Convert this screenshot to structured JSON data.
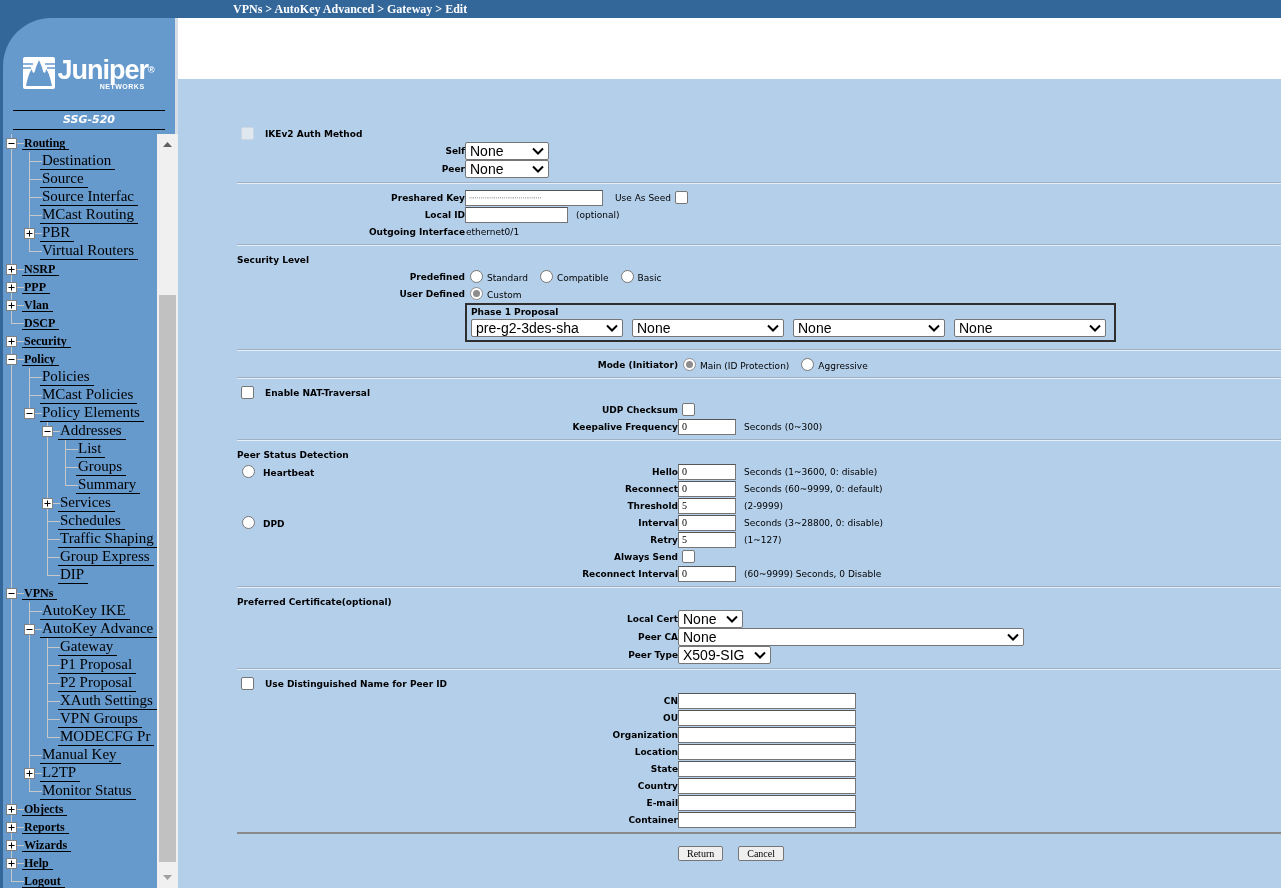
{
  "breadcrumb": "VPNs > AutoKey Advanced > Gateway > Edit",
  "logo": {
    "name": "Juniper$^{®}$",
    "sub": "NETWORKS",
    "model": "SSG-520"
  },
  "tree": [
    {
      "children": [
        {
          "label": "Routing",
          "expanded": true,
          "children": [
            {
              "label": "Destination"
            },
            {
              "label": "Source"
            },
            {
              "label": "Source Interfac"
            },
            {
              "label": "MCast Routing"
            },
            {
              "label": "PBR",
              "expanded": false
            },
            {
              "label": "Virtual Routers"
            }
          ]
        },
        {
          "label": "NSRP",
          "expanded": false
        },
        {
          "label": "PPP",
          "expanded": false
        },
        {
          "label": "Vlan",
          "expanded": false
        },
        {
          "label": "DSCP"
        }
      ]
    },
    {
      "label": "Security",
      "expanded": false
    },
    {
      "label": "Policy",
      "expanded": true,
      "children": [
        {
          "label": "Policies"
        },
        {
          "label": "MCast Policies"
        },
        {
          "label": "Policy Elements",
          "expanded": true,
          "children": [
            {
              "label": "Addresses",
              "expanded": true,
              "children": [
                {
                  "label": "List"
                },
                {
                  "label": "Groups"
                },
                {
                  "label": "Summary"
                }
              ]
            },
            {
              "label": "Services",
              "expanded": false
            },
            {
              "label": "Schedules"
            },
            {
              "label": "Traffic Shaping"
            },
            {
              "label": "Group Express"
            },
            {
              "label": "DIP"
            }
          ]
        }
      ]
    },
    {
      "label": "VPNs",
      "expanded": true,
      "children": [
        {
          "label": "AutoKey IKE"
        },
        {
          "label": "AutoKey Advance",
          "expanded": true,
          "children": [
            {
              "label": "Gateway"
            },
            {
              "label": "P1 Proposal"
            },
            {
              "label": "P2 Proposal"
            },
            {
              "label": "XAuth Settings"
            },
            {
              "label": "VPN Groups"
            },
            {
              "label": "MODECFG Pr"
            }
          ]
        },
        {
          "label": "Manual Key"
        },
        {
          "label": "L2TP",
          "expanded": false
        },
        {
          "label": "Monitor Status"
        }
      ]
    },
    {
      "label": "Objects",
      "expanded": false
    },
    {
      "label": "Reports",
      "expanded": false
    },
    {
      "label": "Wizards",
      "expanded": false
    },
    {
      "label": "Help",
      "expanded": false
    },
    {
      "label": "Logout"
    }
  ],
  "form": {
    "sections": [
      {
        "rows": [
          {
            "kind": "check_title",
            "label": "IKEv2 Auth Method",
            "checked": false,
            "disabled": true
          },
          {
            "kind": "select",
            "label": "Self",
            "value": "None"
          },
          {
            "kind": "select",
            "label": "Peer",
            "value": "None"
          }
        ]
      },
      {
        "rows": [
          {
            "kind": "input",
            "label": "Preshared Key",
            "value": "······································",
            "option": {
              "label": "Use As Seed",
              "checked": false
            }
          },
          {
            "kind": "input",
            "label": "Local ID",
            "hint": "(optional)"
          },
          {
            "kind": "text",
            "label": "Outgoing Interface",
            "value": "ethernet0/1"
          }
        ]
      },
      {
        "rows": [
          {
            "kind": "title",
            "label": "Security Level"
          },
          {
            "kind": "radios",
            "label": "Predefined",
            "options": [
              {
                "label": "Standard",
                "selected": false
              },
              {
                "label": "Compatible",
                "selected": false
              },
              {
                "label": "Basic",
                "selected": false
              }
            ]
          },
          {
            "kind": "radios",
            "label": "User Defined",
            "options": [
              {
                "label": "Custom",
                "selected": true
              }
            ]
          },
          {
            "kind": "proposal",
            "label": "Phase 1 Proposal",
            "values": [
              "pre-g2-3des-sha",
              "None",
              "None",
              "None"
            ]
          }
        ]
      },
      {
        "rows": [
          {
            "kind": "radios",
            "label": "Mode (Initiator)",
            "options": [
              {
                "label": "Main (ID Protection)",
                "selected": true
              },
              {
                "label": "Aggressive",
                "selected": false
              }
            ]
          }
        ]
      },
      {
        "rows": [
          {
            "kind": "check_title",
            "label": "Enable NAT-Traversal",
            "checked": false
          },
          {
            "kind": "checkbox",
            "label": "UDP Checksum",
            "checked": false
          },
          {
            "kind": "input",
            "label": "Keepalive Frequency",
            "value": "0",
            "hint": "Seconds (0~300)"
          }
        ]
      },
      {
        "rows": [
          {
            "kind": "title",
            "label": "Peer Status Detection"
          },
          {
            "kind": "modes",
            "modes": [
              {
                "label": "Heartbeat",
                "selected": false,
                "rows": [
                  {
                    "kind": "input",
                    "label": "Hello",
                    "value": "0",
                    "hint": "Seconds (1~3600, 0: disable)"
                  },
                  {
                    "kind": "input",
                    "label": "Reconnect",
                    "value": "0",
                    "hint": "Seconds (60~9999, 0: default)"
                  },
                  {
                    "kind": "input",
                    "label": "Threshold",
                    "value": "5",
                    "hint": "(2-9999)"
                  }
                ]
              },
              {
                "label": "DPD",
                "selected": false,
                "rows": [
                  {
                    "kind": "input",
                    "label": "Interval",
                    "value": "0",
                    "hint": "Seconds (3~28800, 0: disable)"
                  },
                  {
                    "kind": "input",
                    "label": "Retry",
                    "value": "5",
                    "hint": "(1~127)"
                  },
                  {
                    "kind": "checkbox",
                    "label": "Always Send",
                    "checked": false
                  },
                  {
                    "kind": "input",
                    "label": "Reconnect Interval",
                    "value": "0",
                    "hint": "(60~9999) Seconds, 0 Disable"
                  }
                ]
              }
            ]
          }
        ]
      },
      {
        "rows": [
          {
            "kind": "title",
            "label": "Preferred Certificate(optional)"
          },
          {
            "kind": "select",
            "label": "Local Cert",
            "value": "None"
          },
          {
            "kind": "select",
            "label": "Peer CA",
            "value": "None"
          },
          {
            "kind": "select",
            "label": "Peer Type",
            "value": "X509-SIG"
          }
        ]
      },
      {
        "rows": [
          {
            "kind": "check_title",
            "label": "Use Distinguished Name for Peer ID",
            "checked": false
          },
          {
            "kind": "input",
            "label": "CN"
          },
          {
            "kind": "input",
            "label": "OU"
          },
          {
            "kind": "input",
            "label": "Organization"
          },
          {
            "kind": "input",
            "label": "Location"
          },
          {
            "kind": "input",
            "label": "State"
          },
          {
            "kind": "input",
            "label": "Country"
          },
          {
            "kind": "input",
            "label": "E-mail"
          },
          {
            "kind": "input",
            "label": "Container"
          }
        ]
      }
    ]
  },
  "buttons": [
    "Return",
    "Cancel"
  ]
}
